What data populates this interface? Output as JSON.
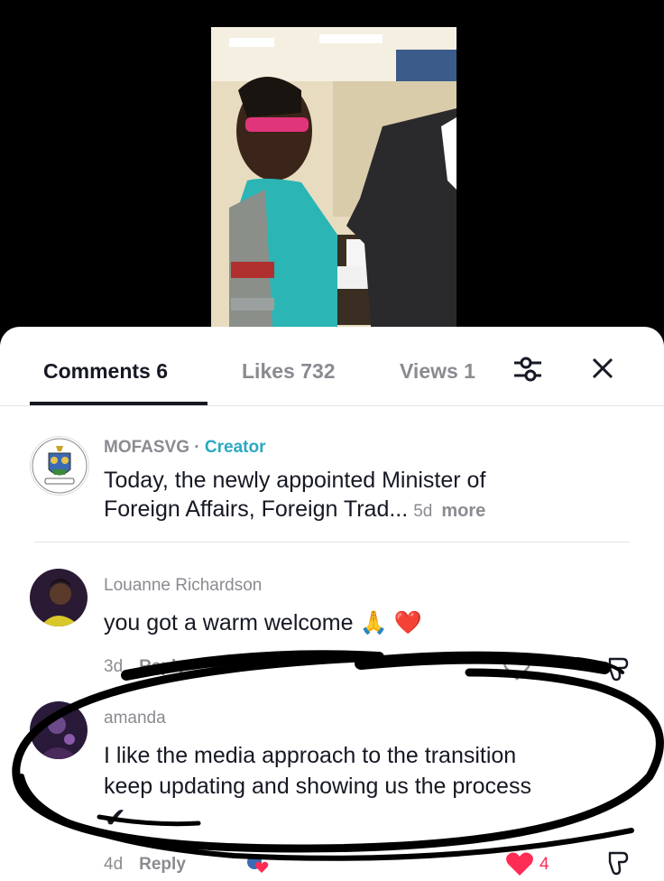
{
  "tabs": [
    {
      "label": "Comments 6"
    },
    {
      "label": "Likes 732"
    },
    {
      "label": "Views 1"
    }
  ],
  "icons": {
    "filter": "sliders-icon",
    "close": "close-icon"
  },
  "comments": [
    {
      "username": "MOFASVG",
      "separator": "·",
      "badge": "Creator",
      "lines": [
        "Today, the newly appointed Minister of",
        "Foreign Affairs, Foreign Trad..."
      ],
      "time": "5d",
      "more": "more"
    },
    {
      "username": "Louanne Richardson",
      "text": "you got a warm welcome",
      "emojis": [
        "🙏",
        "❤️"
      ],
      "time": "3d",
      "reply": "Reply"
    },
    {
      "username": "amanda",
      "lines": [
        "I like the media approach to the transition",
        "keep updating and showing us the process"
      ],
      "emoji_end": "✔",
      "time": "4d",
      "reply": "Reply",
      "likes": "4"
    }
  ],
  "colors": {
    "accent": "#fe2c55",
    "creator": "#2aa8c4",
    "text": "#161823",
    "muted": "#8a8b91"
  }
}
